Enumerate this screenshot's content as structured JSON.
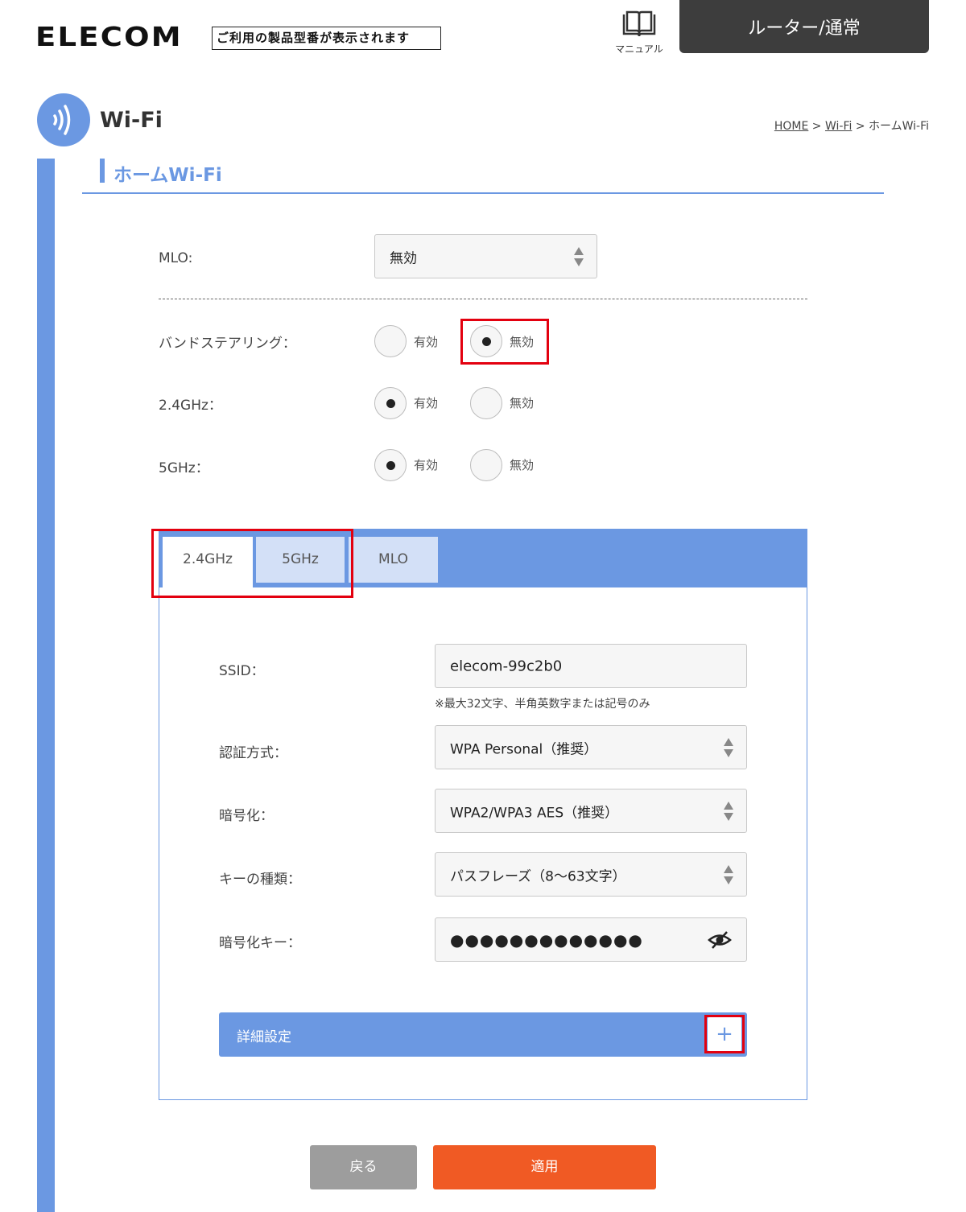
{
  "header": {
    "brand": "ELECOM",
    "model_placeholder": "ご利用の製品型番が表示されます",
    "manual_label": "マニュアル",
    "mode": "ルーター/通常"
  },
  "page": {
    "title": "Wi-Fi",
    "breadcrumb": {
      "home": "HOME",
      "sep1": ">",
      "wifi": "Wi-Fi",
      "sep2": ">",
      "current": "ホームWi-Fi"
    }
  },
  "section": {
    "title": "ホームWi-Fi"
  },
  "mlo": {
    "label": "MLO:",
    "value": "無効"
  },
  "band_steering": {
    "label": "バンドステアリング：",
    "options": [
      "有効",
      "無効"
    ],
    "selected": "無効"
  },
  "ghz24": {
    "label": "2.4GHz：",
    "options": [
      "有効",
      "無効"
    ],
    "selected": "有効"
  },
  "ghz5": {
    "label": "5GHz：",
    "options": [
      "有効",
      "無効"
    ],
    "selected": "有効"
  },
  "tabs": [
    {
      "label": "2.4GHz",
      "active": true
    },
    {
      "label": "5GHz",
      "active": false
    },
    {
      "label": "MLO",
      "active": false
    }
  ],
  "form": {
    "ssid": {
      "label": "SSID：",
      "value": "elecom-99c2b0",
      "hint": "※最大32文字、半角英数字または記号のみ"
    },
    "auth": {
      "label": "認証方式：",
      "value": "WPA Personal（推奨）"
    },
    "encryption": {
      "label": "暗号化：",
      "value": "WPA2/WPA3 AES（推奨）"
    },
    "key_type": {
      "label": "キーの種類：",
      "value": "パスフレーズ（8～63文字）"
    },
    "key": {
      "label": "暗号化キー：",
      "value": "●●●●●●●●●●●●●"
    }
  },
  "advanced": {
    "label": "詳細設定",
    "toggle": "+"
  },
  "buttons": {
    "back": "戻る",
    "apply": "適用"
  },
  "colors": {
    "accent": "#6b98e2",
    "highlight": "#e3000f",
    "apply": "#f05a24",
    "back": "#9d9d9d",
    "mode_bg": "#3d3d3d"
  }
}
